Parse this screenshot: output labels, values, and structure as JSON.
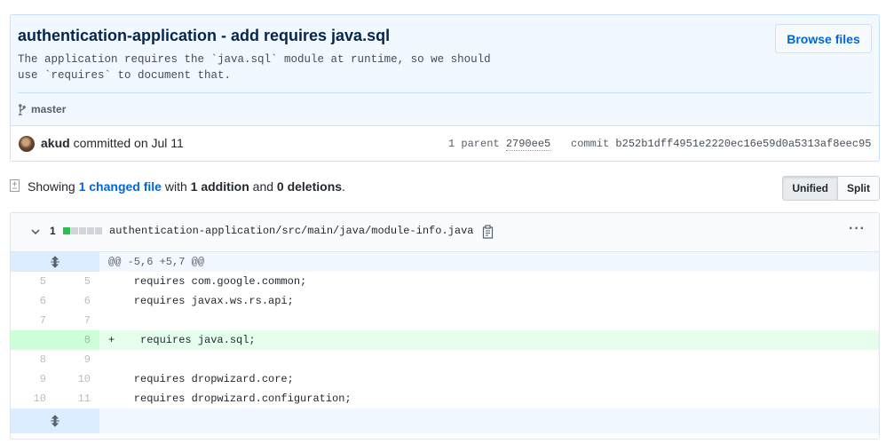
{
  "commit": {
    "title": "authentication-application - add requires java.sql",
    "description": "The application requires the `java.sql` module at runtime, so we should\nuse `requires` to document that.",
    "browse_label": "Browse files",
    "branch": "master",
    "author": "akud",
    "committed_text": " committed on Jul 11",
    "parent_label": "1 parent",
    "parent_sha": "2790ee5",
    "commit_label": "commit",
    "commit_sha": "b252b1dff4951e2220ec16e59d0a5313af8eec95"
  },
  "stats": {
    "showing": "Showing ",
    "changed_files": "1 changed file",
    "with": " with ",
    "additions": "1 addition",
    "and": " and ",
    "deletions": "0 deletions",
    "period": "."
  },
  "view_toggle": {
    "unified": "Unified",
    "split": "Split",
    "selected": "Unified"
  },
  "file": {
    "change_count": "1",
    "diffstat": [
      "add",
      "neutral",
      "neutral",
      "neutral",
      "neutral"
    ],
    "path": "authentication-application/src/main/java/module-info.java",
    "hunk_header": "@@ -5,6 +5,7 @@",
    "lines": [
      {
        "old": "5",
        "new": "5",
        "code": "    requires com.google.common;",
        "type": "context"
      },
      {
        "old": "6",
        "new": "6",
        "code": "    requires javax.ws.rs.api;",
        "type": "context"
      },
      {
        "old": "7",
        "new": "7",
        "code": "",
        "type": "context"
      },
      {
        "old": "",
        "new": "8",
        "code": "+    requires java.sql;",
        "type": "added"
      },
      {
        "old": "8",
        "new": "9",
        "code": "",
        "type": "context"
      },
      {
        "old": "9",
        "new": "10",
        "code": "    requires dropwizard.core;",
        "type": "context"
      },
      {
        "old": "10",
        "new": "11",
        "code": "    requires dropwizard.configuration;",
        "type": "context"
      }
    ]
  },
  "colors": {
    "accent": "#0366d6",
    "added_bg": "#e6ffed",
    "added_num_bg": "#cdffd8",
    "hunk_bg": "#f1f8ff",
    "header_bg": "#f1f8ff"
  }
}
